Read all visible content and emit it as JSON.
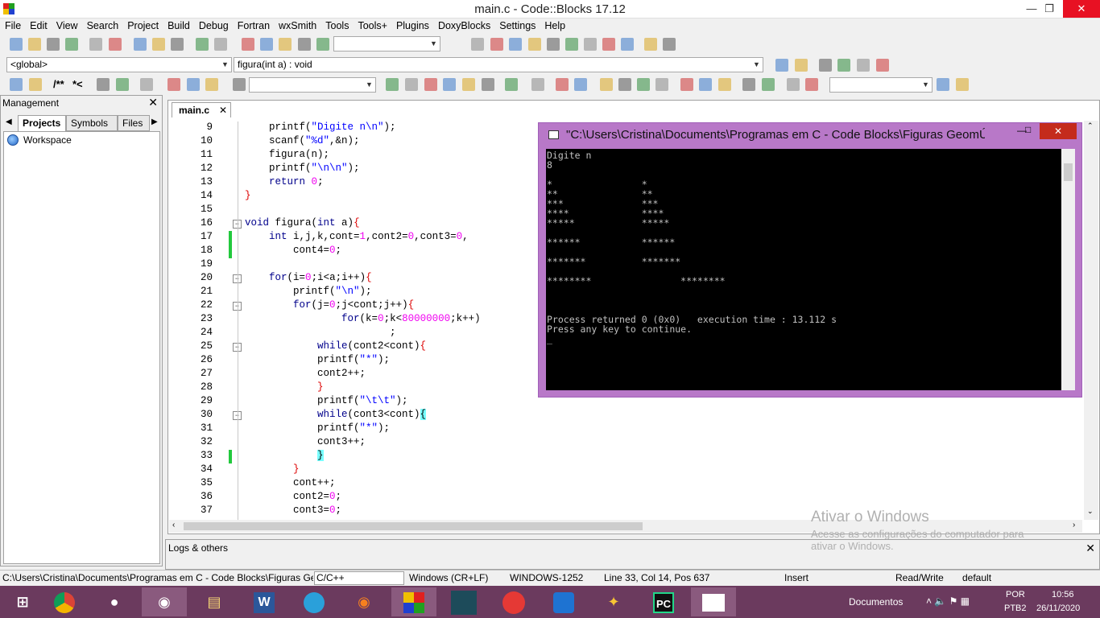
{
  "window": {
    "title": "main.c - Code::Blocks 17.12"
  },
  "menu": [
    "File",
    "Edit",
    "View",
    "Search",
    "Project",
    "Build",
    "Debug",
    "Fortran",
    "wxSmith",
    "Tools",
    "Tools+",
    "Plugins",
    "DoxyBlocks",
    "Settings",
    "Help"
  ],
  "toolbar3": {
    "scope": "<global>",
    "function": "figura(int a) : void",
    "comment_label": "/**",
    "comment2_label": "*<"
  },
  "management": {
    "title": "Management",
    "tabs": [
      "Projects",
      "Symbols",
      "Files"
    ],
    "tree_root": "Workspace"
  },
  "editor": {
    "tab": "main.c",
    "lines": [
      {
        "n": "9",
        "html": "    printf(<span class='str'>\"Digite n\\n\"</span>);"
      },
      {
        "n": "10",
        "html": "    scanf(<span class='str'>\"%d\"</span>,&amp;n);"
      },
      {
        "n": "11",
        "html": "    figura(n);"
      },
      {
        "n": "12",
        "html": "    printf(<span class='str'>\"\\n\\n\"</span>);"
      },
      {
        "n": "13",
        "html": "    <span class='kw'>return</span> <span class='num'>0</span>;"
      },
      {
        "n": "14",
        "html": "<span class='op'>}</span>"
      },
      {
        "n": "15",
        "html": ""
      },
      {
        "n": "16",
        "html": "<span class='kw'>void</span> figura(<span class='kw'>int</span> a)<span class='op'>{</span>"
      },
      {
        "n": "17",
        "html": "    <span class='kw'>int</span> i,j,k,cont=<span class='num'>1</span>,cont2=<span class='num'>0</span>,cont3=<span class='num'>0</span>,"
      },
      {
        "n": "18",
        "html": "        cont4=<span class='num'>0</span>;"
      },
      {
        "n": "19",
        "html": ""
      },
      {
        "n": "20",
        "html": "    <span class='kw'>for</span>(i=<span class='num'>0</span>;i&lt;a;i++)<span class='op'>{</span>"
      },
      {
        "n": "21",
        "html": "        printf(<span class='str'>\"\\n\"</span>);"
      },
      {
        "n": "22",
        "html": "        <span class='kw'>for</span>(j=<span class='num'>0</span>;j&lt;cont;j++)<span class='op'>{</span>"
      },
      {
        "n": "23",
        "html": "                <span class='kw'>for</span>(k=<span class='num'>0</span>;k&lt;<span class='num'>80000000</span>;k++)"
      },
      {
        "n": "24",
        "html": "                        ;"
      },
      {
        "n": "25",
        "html": "            <span class='kw'>while</span>(cont2&lt;cont)<span class='op'>{</span>"
      },
      {
        "n": "26",
        "html": "            printf(<span class='str'>\"*\"</span>);"
      },
      {
        "n": "27",
        "html": "            cont2++;"
      },
      {
        "n": "28",
        "html": "            <span class='op'>}</span>"
      },
      {
        "n": "29",
        "html": "            printf(<span class='str'>\"\\t\\t\"</span>);"
      },
      {
        "n": "30",
        "html": "            <span class='kw'>while</span>(cont3&lt;cont)<span style='background:#7ff'>{</span>"
      },
      {
        "n": "31",
        "html": "            printf(<span class='str'>\"*\"</span>);"
      },
      {
        "n": "32",
        "html": "            cont3++;"
      },
      {
        "n": "33",
        "html": "            <span style='background:#7ff'>}</span>"
      },
      {
        "n": "34",
        "html": "        <span class='op'>}</span>"
      },
      {
        "n": "35",
        "html": "        cont++;"
      },
      {
        "n": "36",
        "html": "        cont2=<span class='num'>0</span>;"
      },
      {
        "n": "37",
        "html": "        cont3=<span class='num'>0</span>;"
      }
    ]
  },
  "console": {
    "title": "\"C:\\Users\\Cristina\\Documents\\Programas em C - Code Blocks\\Figuras GeomÚtri...",
    "lines": [
      "Digite n",
      "8",
      "",
      "*                *",
      "**               **",
      "***              ***",
      "****             ****",
      "*****            *****",
      "",
      "******           ******",
      "",
      "*******          *******",
      "",
      "********                ********",
      "",
      "",
      "",
      "Process returned 0 (0x0)   execution time : 13.112 s",
      "Press any key to continue.",
      "_"
    ]
  },
  "logs": {
    "title": "Logs & others"
  },
  "status": {
    "path": "C:\\Users\\Cristina\\Documents\\Programas em C - Code Blocks\\Figuras Ge",
    "lang": "C/C++",
    "eol": "Windows (CR+LF)",
    "enc": "WINDOWS-1252",
    "pos": "Line 33, Col 14, Pos 637",
    "mode": "Insert",
    "rw": "Read/Write",
    "prof": "default"
  },
  "watermark": {
    "title": "Ativar o Windows",
    "sub": "Acesse as configurações do computador para",
    "sub2": "ativar o Windows."
  },
  "taskbar": {
    "documentos": "Documentos",
    "lang": "POR",
    "layout": "PTB2",
    "time": "10:56",
    "date": "26/11/2020"
  }
}
